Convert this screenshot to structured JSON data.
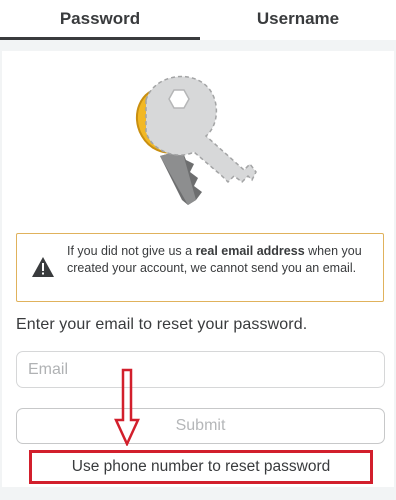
{
  "tabs": [
    {
      "label": "Password",
      "active": true
    },
    {
      "label": "Username",
      "active": false
    }
  ],
  "illustration": {
    "icon": "key-icon"
  },
  "warning": {
    "icon": "warning-icon",
    "text_before": "If you did not give us a ",
    "text_bold": "real email address",
    "text_after": " when you created your account, we cannot send you an email.",
    "border_color": "#e0b25c"
  },
  "form": {
    "instruction": "Enter your email to reset your password.",
    "email_placeholder": "Email",
    "email_value": "",
    "submit_label": "Submit",
    "submit_enabled": false
  },
  "phone_link": {
    "label": "Use phone number to reset password"
  },
  "annotation": {
    "icon": "arrow-down-icon",
    "color": "#d21f2c"
  }
}
